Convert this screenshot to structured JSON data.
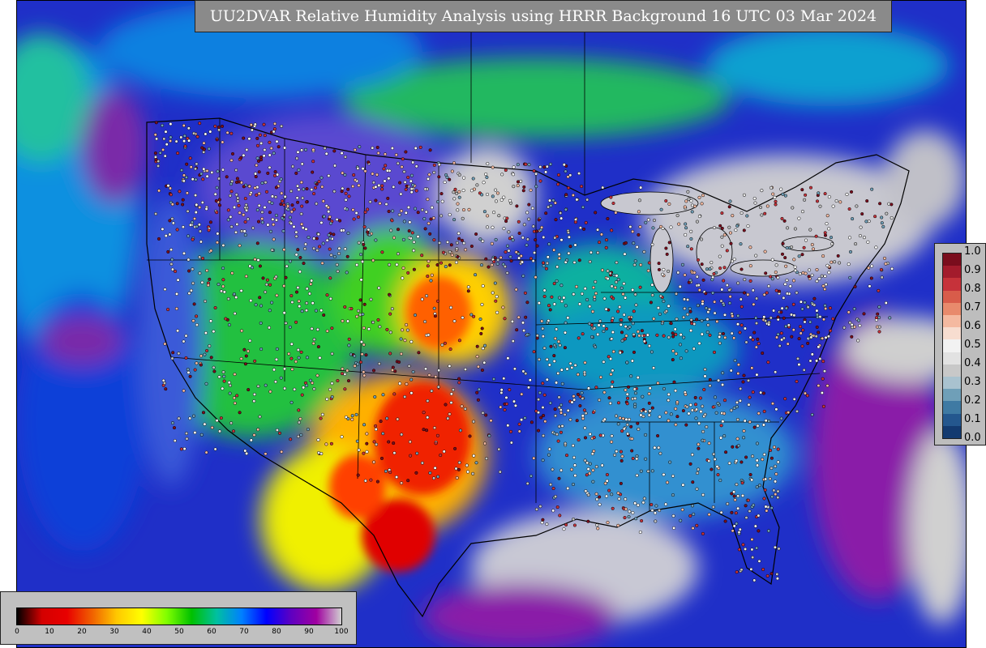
{
  "title": "UU2DVAR Relative Humidity Analysis using HRRR Background 16 UTC 03 Mar 2024",
  "obs_legend": {
    "ticks": [
      "1.0",
      "0.9",
      "0.8",
      "0.7",
      "0.6",
      "0.5",
      "0.4",
      "0.3",
      "0.2",
      "0.1",
      "0.0"
    ],
    "colors": [
      "#7a0d1d",
      "#a31b2c",
      "#c6323a",
      "#d85c4a",
      "#e88a6c",
      "#f4b9a0",
      "#f7ddd0",
      "#f2f2f2",
      "#e2e2e2",
      "#c8c8c8",
      "#a9c2cf",
      "#6f9fb8",
      "#3f7aa3",
      "#24578e",
      "#133a70"
    ]
  },
  "rh_colorbar": {
    "ticks": [
      "0",
      "10",
      "20",
      "30",
      "40",
      "50",
      "60",
      "70",
      "80",
      "90",
      "100"
    ],
    "gradient_colors": [
      "#000000",
      "#d40000",
      "#e80000",
      "#f06000",
      "#ffc800",
      "#ffff00",
      "#80ff00",
      "#00c000",
      "#00c0a0",
      "#0080ff",
      "#0000ff",
      "#6000c0",
      "#a000a0",
      "#d0d0d0"
    ]
  },
  "colors": {
    "very_dry": "#d40000",
    "dry": "#ff8000",
    "moderate": "#ffff00",
    "humid": "#00c000",
    "moist": "#00a0c0",
    "wet": "#1a2fd0",
    "very_wet": "#8a1aa8",
    "saturated": "#d0d0d0",
    "background": "#1f2fc8"
  }
}
